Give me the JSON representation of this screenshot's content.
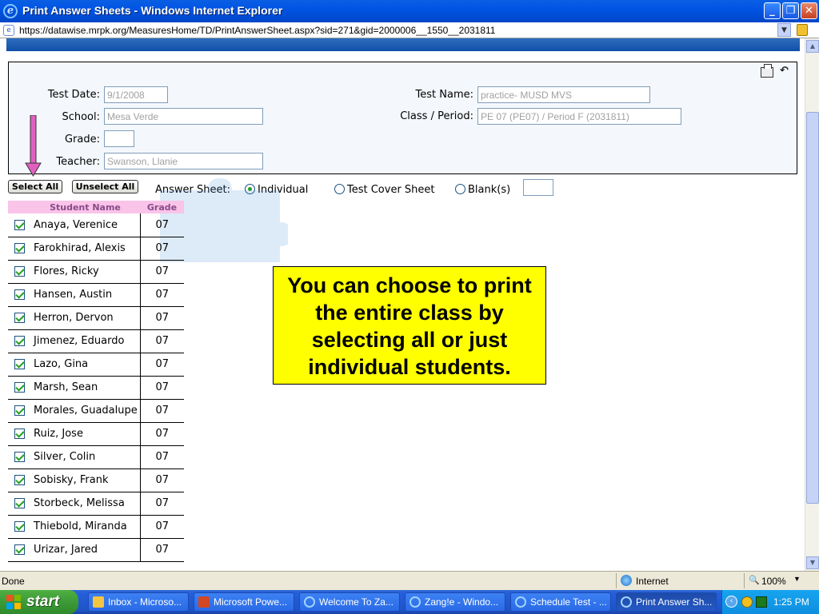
{
  "window": {
    "title": "Print Answer Sheets - Windows Internet Explorer",
    "url": "https://datawise.mrpk.org/MeasuresHome/TD/PrintAnswerSheet.aspx?sid=271&gid=2000006__1550__2031811"
  },
  "form": {
    "test_date_label": "Test Date:",
    "test_date_value": "9/1/2008",
    "school_label": "School:",
    "school_value": "Mesa Verde",
    "grade_label": "Grade:",
    "grade_value": "",
    "teacher_label": "Teacher:",
    "teacher_value": "Swanson, Llanie",
    "test_name_label": "Test Name:",
    "test_name_value": "practice- MUSD MVS",
    "class_period_label": "Class / Period:",
    "class_period_value": "PE 07 (PE07) / Period F (2031811)"
  },
  "controls": {
    "select_all": "Select All",
    "unselect_all": "Unselect All",
    "answer_sheet_label": "Answer Sheet:",
    "opt_individual": "Individual",
    "opt_cover": "Test Cover Sheet",
    "opt_blank": "Blank(s)",
    "selected_option": "Individual"
  },
  "table": {
    "headers": [
      "",
      "Student Name",
      "Grade"
    ],
    "rows": [
      {
        "name": "Anaya, Verenice",
        "grade": "07",
        "checked": true
      },
      {
        "name": "Farokhirad, Alexis",
        "grade": "07",
        "checked": true
      },
      {
        "name": "Flores, Ricky",
        "grade": "07",
        "checked": true
      },
      {
        "name": "Hansen, Austin",
        "grade": "07",
        "checked": true
      },
      {
        "name": "Herron, Dervon",
        "grade": "07",
        "checked": true
      },
      {
        "name": "Jimenez, Eduardo",
        "grade": "07",
        "checked": true
      },
      {
        "name": "Lazo, Gina",
        "grade": "07",
        "checked": true
      },
      {
        "name": "Marsh, Sean",
        "grade": "07",
        "checked": true
      },
      {
        "name": "Morales, Guadalupe",
        "grade": "07",
        "checked": true
      },
      {
        "name": "Ruiz, Jose",
        "grade": "07",
        "checked": true
      },
      {
        "name": "Silver, Colin",
        "grade": "07",
        "checked": true
      },
      {
        "name": "Sobisky, Frank",
        "grade": "07",
        "checked": true
      },
      {
        "name": "Storbeck, Melissa",
        "grade": "07",
        "checked": true
      },
      {
        "name": "Thiebold, Miranda",
        "grade": "07",
        "checked": true
      },
      {
        "name": "Urizar, Jared",
        "grade": "07",
        "checked": true
      }
    ]
  },
  "callout": {
    "text": "You can choose to print the entire class by selecting all or just individual students."
  },
  "statusbar": {
    "status": "Done",
    "zone": "Internet",
    "zoom": "100%"
  },
  "taskbar": {
    "start_label": "start",
    "tasks": [
      {
        "label": "Inbox - Microso..."
      },
      {
        "label": "Microsoft Powe..."
      },
      {
        "label": "Welcome To Za..."
      },
      {
        "label": "Zang!e - Windo..."
      },
      {
        "label": "Schedule Test - ..."
      },
      {
        "label": "Print Answer Sh..."
      }
    ],
    "clock": "1:25 PM"
  },
  "colors": {
    "callout_bg": "#ffff00",
    "table_header_bg": "#f9c4e8",
    "arrow": "#e060c0",
    "check": "#21a121"
  }
}
